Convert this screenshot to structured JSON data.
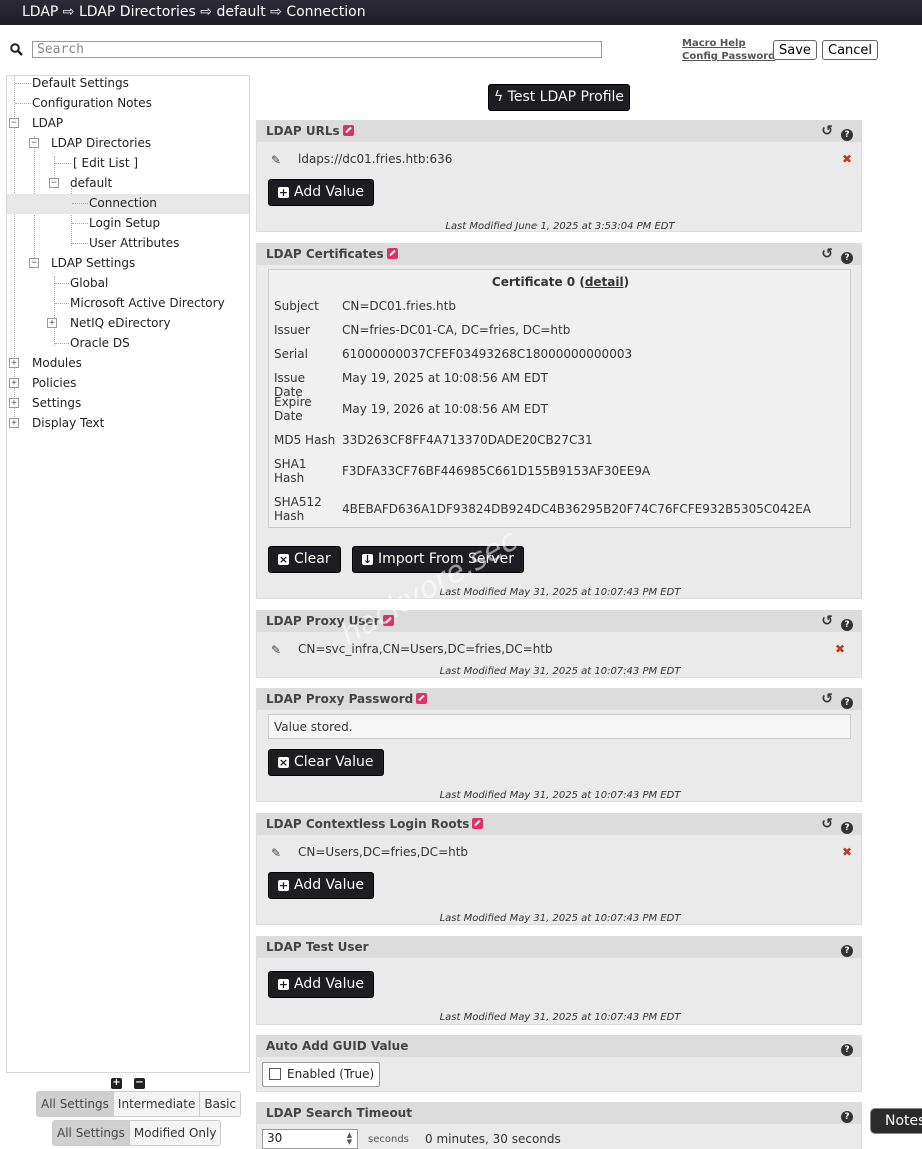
{
  "breadcrumb": "LDAP ⇨ LDAP Directories ⇨ default ⇨ Connection",
  "search": {
    "placeholder": "Search",
    "value": ""
  },
  "toplinks": {
    "macro_help": "Macro Help",
    "config_password": "Config Password"
  },
  "buttons": {
    "save": "Save",
    "cancel": "Cancel",
    "test_profile": "ϟ Test LDAP Profile"
  },
  "tree": {
    "default_settings": "Default Settings",
    "configuration_notes": "Configuration Notes",
    "ldap": "LDAP",
    "ldap_directories": "LDAP Directories",
    "edit_list": "[ Edit List ]",
    "default": "default",
    "connection": "Connection",
    "login_setup": "Login Setup",
    "user_attributes": "User Attributes",
    "ldap_settings": "LDAP Settings",
    "global": "Global",
    "microsoft_ad": "Microsoft Active Directory",
    "netiq": "NetIQ eDirectory",
    "oracle": "Oracle DS",
    "modules": "Modules",
    "policies": "Policies",
    "settings": "Settings",
    "display_text": "Display Text"
  },
  "level_filter": [
    "All Settings",
    "Intermediate",
    "Basic"
  ],
  "modified_filter": [
    "All Settings",
    "Modified Only"
  ],
  "panels": {
    "ldap_urls": {
      "title": "LDAP URLs",
      "value": "ldaps://dc01.fries.htb:636",
      "add": "Add Value",
      "last_modified": "Last Modified June 1, 2025 at 3:53:04 PM EDT"
    },
    "ldap_certs": {
      "title": "LDAP Certificates",
      "cert_title": "Certificate 0",
      "detail": "detail",
      "rows": [
        {
          "k": "Subject",
          "v": "CN=DC01.fries.htb"
        },
        {
          "k": "Issuer",
          "v": "CN=fries-DC01-CA, DC=fries, DC=htb"
        },
        {
          "k": "Serial",
          "v": "61000000037CFEF03493268C18000000000003"
        },
        {
          "k": "Issue Date",
          "v": "May 19, 2025 at 10:08:56 AM EDT"
        },
        {
          "k": "Expire Date",
          "v": "May 19, 2026 at 10:08:56 AM EDT"
        },
        {
          "k": "MD5 Hash",
          "v": "33D263CF8FF4A713370DADE20CB27C31"
        },
        {
          "k": "SHA1 Hash",
          "v": "F3DFA33CF76BF446985C661D155B9153AF30EE9A"
        },
        {
          "k": "SHA512 Hash",
          "v": "4BEBAFD636A1DF93824DB924DC4B36295B20F74C76FCFE932B5305C042EA"
        }
      ],
      "clear": "Clear",
      "import": "Import From Server",
      "last_modified": "Last Modified May 31, 2025 at 10:07:43 PM EDT"
    },
    "proxy_user": {
      "title": "LDAP Proxy User",
      "value": "CN=svc_infra,CN=Users,DC=fries,DC=htb",
      "last_modified": "Last Modified May 31, 2025 at 10:07:43 PM EDT"
    },
    "proxy_password": {
      "title": "LDAP Proxy Password",
      "stored": "Value stored.",
      "clear": "Clear Value",
      "last_modified": "Last Modified May 31, 2025 at 10:07:43 PM EDT"
    },
    "contextless": {
      "title": "LDAP Contextless Login Roots",
      "value": "CN=Users,DC=fries,DC=htb",
      "add": "Add Value",
      "last_modified": "Last Modified May 31, 2025 at 10:07:43 PM EDT"
    },
    "test_user": {
      "title": "LDAP Test User",
      "add": "Add Value",
      "last_modified": "Last Modified May 31, 2025 at 10:07:43 PM EDT"
    },
    "auto_guid": {
      "title": "Auto Add GUID Value",
      "checkbox": "Enabled (True)"
    },
    "search_timeout": {
      "title": "LDAP Search Timeout",
      "value": "30",
      "unit": "seconds",
      "readable": "0 minutes, 30 seconds"
    }
  },
  "notes_tab": "Notes",
  "watermark": "hackvore.sec"
}
